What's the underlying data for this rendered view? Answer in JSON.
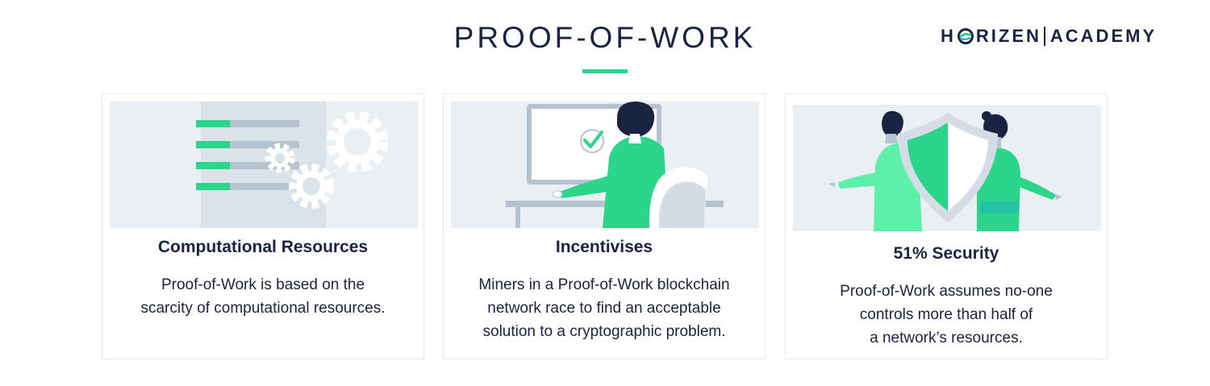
{
  "header": {
    "title": "PROOF-OF-WORK",
    "brand": {
      "part1": "H",
      "part2": "RIZEN",
      "part3": "ACADEMY"
    }
  },
  "colors": {
    "navy": "#1b2342",
    "green": "#2bd68b",
    "light_green": "#5cf0a8",
    "panel_gray": "#eaeff3",
    "bar_gray": "#b4c3cf"
  },
  "cards": [
    {
      "title": "Computational Resources",
      "lines": [
        "Proof-of-Work is based on the",
        "scarcity of computational resources."
      ],
      "illustration": "gears-and-bars"
    },
    {
      "title": "Incentivises",
      "lines": [
        "Miners in a Proof-of-Work blockchain",
        "network race to find an acceptable",
        "solution to a cryptographic problem."
      ],
      "illustration": "miner-at-computer-checkmark"
    },
    {
      "title": "51% Security",
      "lines": [
        "Proof-of-Work assumes no-one",
        "controls more than half of",
        "a network’s resources."
      ],
      "illustration": "people-with-shield"
    }
  ]
}
